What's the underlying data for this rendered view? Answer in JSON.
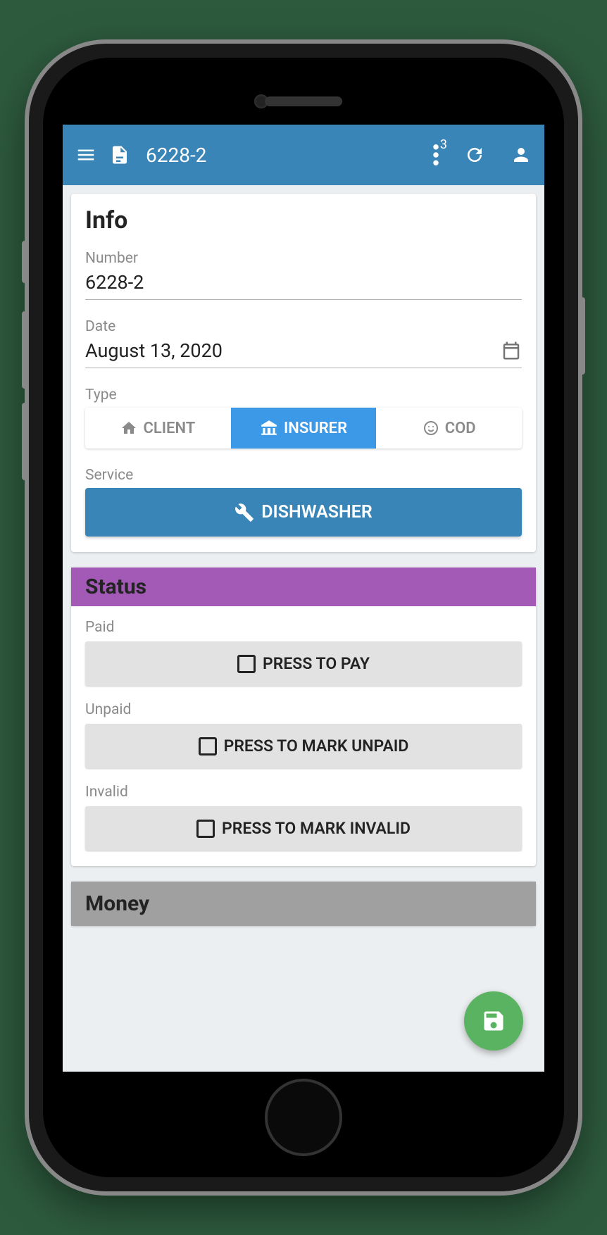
{
  "appbar": {
    "title": "6228-2",
    "notification_count": "3"
  },
  "info": {
    "title": "Info",
    "number_label": "Number",
    "number_value": "6228-2",
    "date_label": "Date",
    "date_value": "August 13, 2020",
    "type_label": "Type",
    "types": {
      "client": "CLIENT",
      "insurer": "INSURER",
      "cod": "COD"
    },
    "service_label": "Service",
    "service_value": "DISHWASHER"
  },
  "status": {
    "title": "Status",
    "paid_label": "Paid",
    "paid_button": "PRESS TO PAY",
    "unpaid_label": "Unpaid",
    "unpaid_button": "PRESS TO MARK UNPAID",
    "invalid_label": "Invalid",
    "invalid_button": "PRESS TO MARK INVALID"
  },
  "money": {
    "title": "Money"
  }
}
